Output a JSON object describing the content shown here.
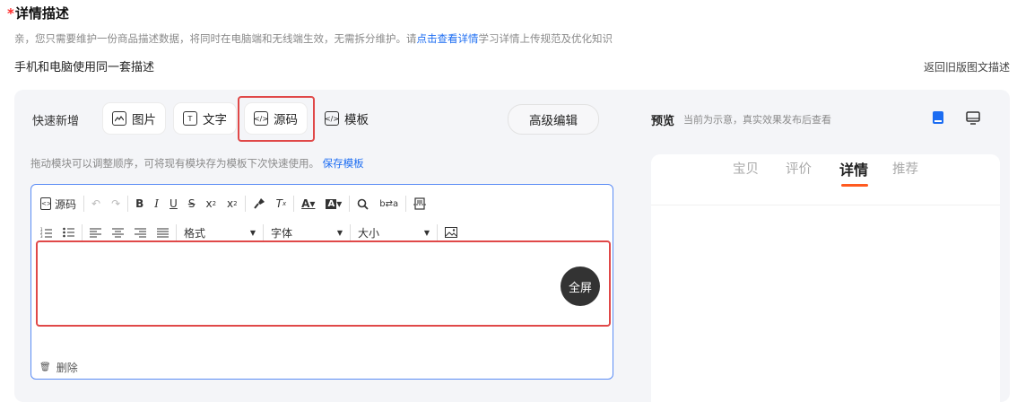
{
  "header": {
    "required_mark": "*",
    "title": "详情描述",
    "subtitle_prefix": "亲，您只需要维护一份商品描述数据，将同时在电脑端和无线端生效，无需拆分维护。请",
    "subtitle_link": "点击查看详情",
    "subtitle_suffix": "学习详情上传规范及优化知识",
    "section_label": "手机和电脑使用同一套描述",
    "back_link": "返回旧版图文描述"
  },
  "quick_add": {
    "label": "快速新增",
    "buttons": [
      {
        "label": "图片",
        "icon": "image-icon"
      },
      {
        "label": "文字",
        "icon": "text-icon"
      },
      {
        "label": "源码",
        "icon": "code-icon"
      },
      {
        "label": "模板",
        "icon": "template-icon"
      }
    ],
    "advanced": "高级编辑"
  },
  "hint": {
    "text": "拖动模块可以调整顺序，可将现有模块存为模板下次快速使用。",
    "link": "保存模板"
  },
  "editor": {
    "source_label": "源码",
    "format_label": "格式",
    "font_label": "字体",
    "size_label": "大小",
    "fullscreen": "全屏",
    "delete": "删除"
  },
  "preview": {
    "label": "预览",
    "note": "当前为示意，真实效果发布后查看",
    "tabs": [
      "宝贝",
      "评价",
      "详情",
      "推荐"
    ],
    "active_tab": "详情",
    "active_color": "#ff5a1f",
    "accent_color": "#1b6cf2"
  }
}
